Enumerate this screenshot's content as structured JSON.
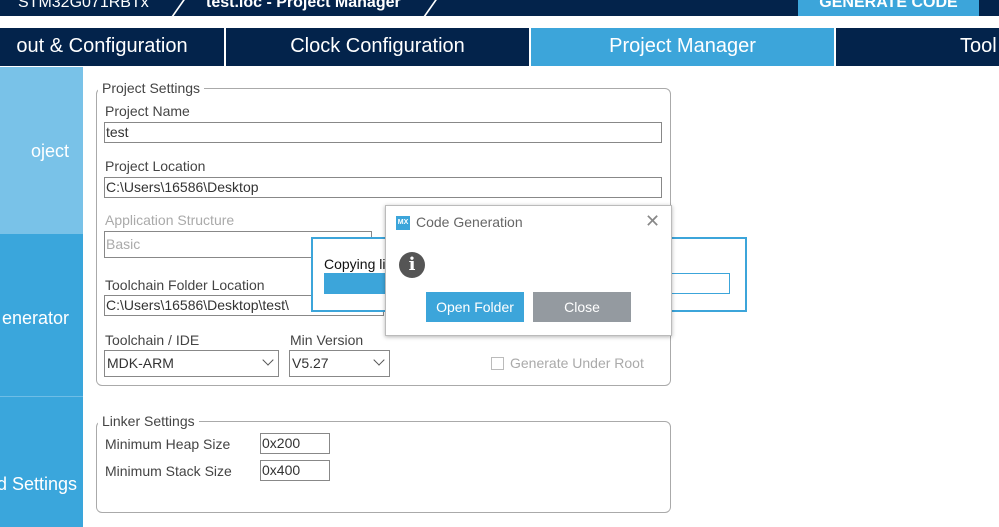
{
  "topbar": {
    "chip": "STM32G071RBTx",
    "file": "test.ioc - Project Manager",
    "generate": "GENERATE CODE"
  },
  "tabs": [
    "out & Configuration",
    "Clock Configuration",
    "Project Manager",
    "Tool"
  ],
  "sidebar": [
    "oject",
    "enerator",
    "d Settings"
  ],
  "project_settings": {
    "title": "Project Settings",
    "name_label": "Project Name",
    "name": "test",
    "location_label": "Project Location",
    "location": "C:\\Users\\16586\\Desktop",
    "app_label": "Application Structure",
    "app": "Basic",
    "toolchain_folder_label": "Toolchain Folder Location",
    "toolchain_folder": "C:\\Users\\16586\\Desktop\\test\\",
    "ide_label": "Toolchain / IDE",
    "ide": "MDK-ARM",
    "min_version_label": "Min Version",
    "min_version": "V5.27",
    "generate_root": "Generate Under Root"
  },
  "linker": {
    "title": "Linker Settings",
    "heap_label": "Minimum Heap Size",
    "heap": "0x200",
    "stack_label": "Minimum Stack Size",
    "stack": "0x400"
  },
  "progress": {
    "text": "Copying lil"
  },
  "dialog": {
    "logo": "MX",
    "title": "Code Generation",
    "open": "Open Folder",
    "close": "Close"
  }
}
